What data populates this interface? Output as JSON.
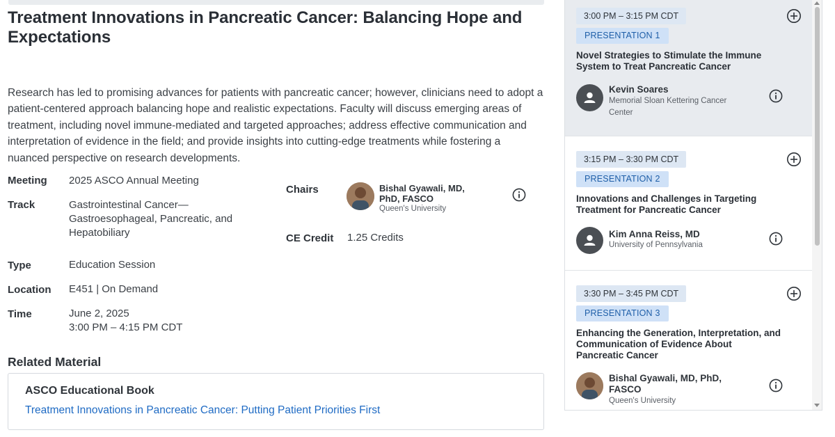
{
  "session": {
    "title": "Treatment Innovations in Pancreatic Cancer: Balancing Hope and Expectations",
    "description": "Research has led to promising advances for patients with pancreatic cancer; however, clinicians need to adopt a patient-centered approach balancing hope and realistic expectations. Faculty will discuss emerging areas of treatment, including novel immune-mediated and targeted approaches; address effective communication and interpretation of evidence in the field; and provide insights into cutting-edge treatments while fostering a nuanced perspective on research developments."
  },
  "meta": {
    "meeting_label": "Meeting",
    "meeting_value": "2025 ASCO Annual Meeting",
    "track_label": "Track",
    "track_value_1": "Gastrointestinal Cancer—",
    "track_value_2": "Gastroesophageal, Pancreatic, and",
    "track_value_3": "Hepatobiliary",
    "type_label": "Type",
    "type_value": "Education Session",
    "location_label": "Location",
    "location_value": "E451 | On Demand",
    "time_label": "Time",
    "time_date": "June 2, 2025",
    "time_range": "3:00 PM – 4:15 PM CDT",
    "chairs_label": "Chairs",
    "chair_name_1": "Bishal Gyawali, MD,",
    "chair_name_2": "PhD, FASCO",
    "chair_institution": "Queen's University",
    "ce_label": "CE Credit",
    "ce_value": "1.25 Credits"
  },
  "related": {
    "heading": "Related Material",
    "box_title": "ASCO Educational Book",
    "link_text": "Treatment Innovations in Pancreatic Cancer: Putting Patient Priorities First"
  },
  "presentations": [
    {
      "time": "3:00 PM – 3:15 PM CDT",
      "label": "PRESENTATION 1",
      "title_1": "Novel Strategies to Stimulate the Immune",
      "title_2": "System to Treat Pancreatic Cancer",
      "speaker": "Kevin Soares",
      "institution_1": "Memorial Sloan Kettering Cancer",
      "institution_2": "Center"
    },
    {
      "time": "3:15 PM – 3:30 PM CDT",
      "label": "PRESENTATION 2",
      "title_1": "Innovations and Challenges in Targeting",
      "title_2": "Treatment for Pancreatic Cancer",
      "speaker": "Kim Anna Reiss, MD",
      "institution_1": "University of Pennsylvania"
    },
    {
      "time": "3:30 PM – 3:45 PM CDT",
      "label": "PRESENTATION 3",
      "title_1": "Enhancing the Generation, Interpretation, and",
      "title_2": "Communication of Evidence About",
      "title_3": "Pancreatic Cancer",
      "speaker_1": "Bishal Gyawali, MD, PhD,",
      "speaker_2": "FASCO",
      "institution_1": "Queen's University"
    }
  ],
  "colors": {
    "link": "#1f6bc4",
    "chip_time_bg": "#dde7f3",
    "chip_presentation_bg": "#cfe1f7",
    "active_card_bg": "#e8ebef"
  }
}
